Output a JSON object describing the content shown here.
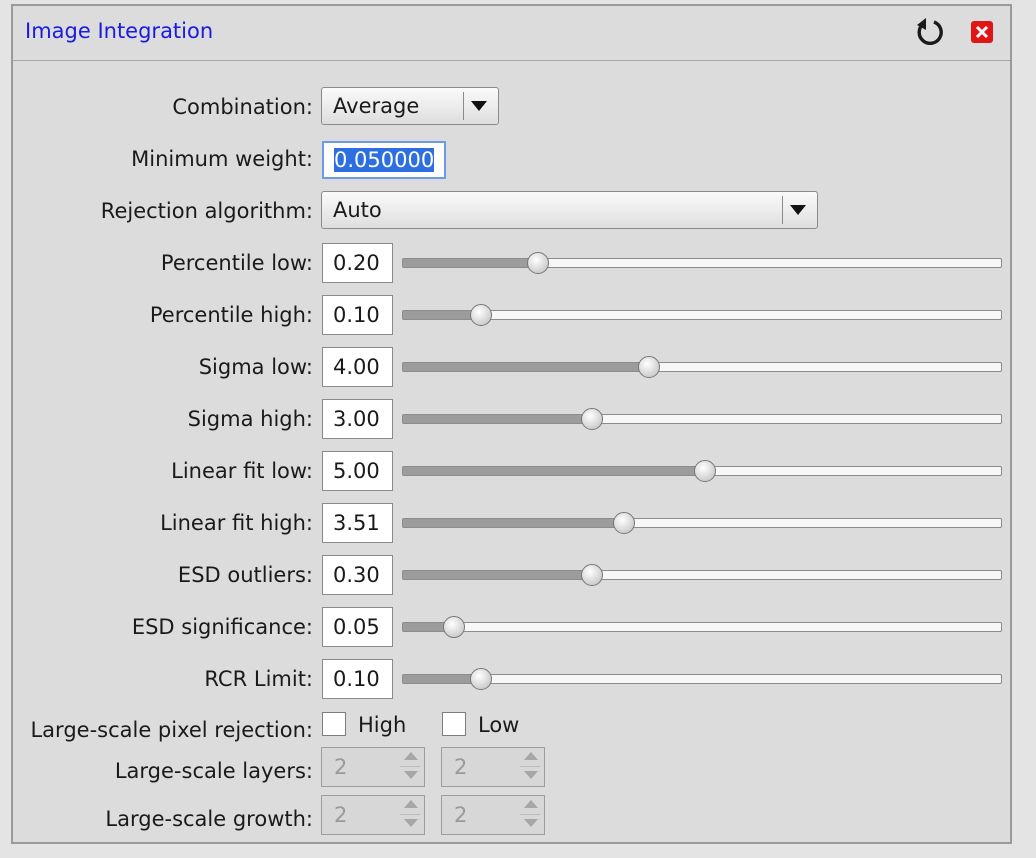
{
  "window": {
    "title": "Image Integration",
    "reset_icon": "reset-icon",
    "close_icon": "close-icon"
  },
  "combination": {
    "label": "Combination:",
    "value": "Average"
  },
  "min_weight": {
    "label": "Minimum weight:",
    "value": "0.050000"
  },
  "rejection": {
    "label": "Rejection algorithm:",
    "value": "Auto"
  },
  "sliders": [
    {
      "label": "Percentile low:",
      "value": "0.20",
      "fraction": 0.225
    },
    {
      "label": "Percentile high:",
      "value": "0.10",
      "fraction": 0.13
    },
    {
      "label": "Sigma low:",
      "value": "4.00",
      "fraction": 0.41
    },
    {
      "label": "Sigma high:",
      "value": "3.00",
      "fraction": 0.315
    },
    {
      "label": "Linear fit low:",
      "value": "5.00",
      "fraction": 0.503
    },
    {
      "label": "Linear fit high:",
      "value": "3.51",
      "fraction": 0.368
    },
    {
      "label": "ESD outliers:",
      "value": "0.30",
      "fraction": 0.315
    },
    {
      "label": "ESD significance:",
      "value": "0.05",
      "fraction": 0.085
    },
    {
      "label": "RCR Limit:",
      "value": "0.10",
      "fraction": 0.13
    }
  ],
  "large_scale_rejection": {
    "label": "Large-scale pixel rejection:",
    "high_label": "High",
    "low_label": "Low",
    "high_checked": false,
    "low_checked": false
  },
  "large_scale_layers": {
    "label": "Large-scale layers:",
    "high_value": "2",
    "low_value": "2"
  },
  "large_scale_growth": {
    "label": "Large-scale growth:",
    "high_value": "2",
    "low_value": "2"
  }
}
